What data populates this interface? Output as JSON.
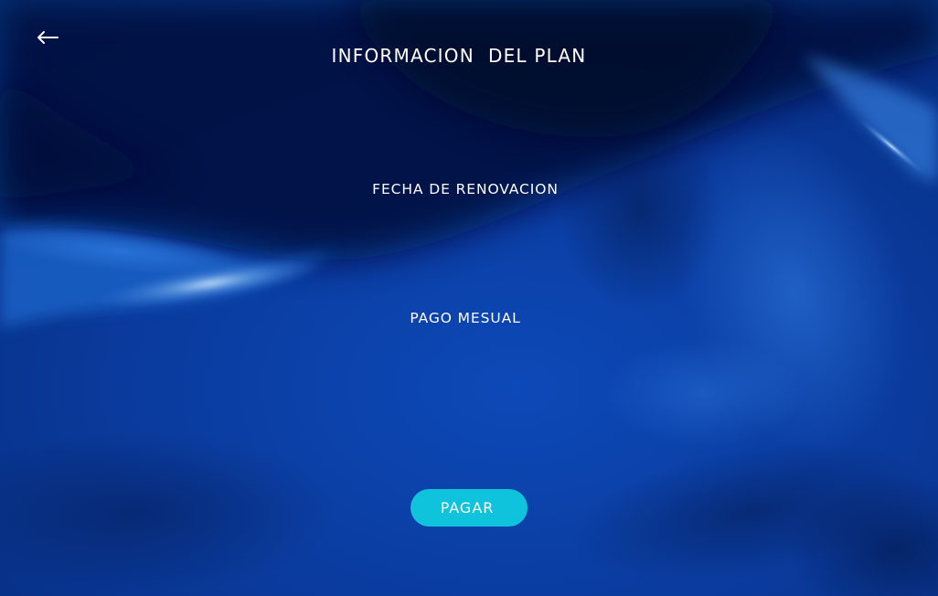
{
  "header": {
    "title": "INFORMACION  DEL PLAN"
  },
  "plan_info": {
    "renewal_date_label": "FECHA DE RENOVACION",
    "monthly_payment_label": "PAGO MESUAL"
  },
  "actions": {
    "pay_label": "PAGAR"
  },
  "icons": {
    "back": "arrow-left-icon"
  },
  "colors": {
    "background_dark": "#03123f",
    "background_primary": "#0a3d9e",
    "accent_button": "#0fc3dc",
    "text": "#ffffff"
  }
}
